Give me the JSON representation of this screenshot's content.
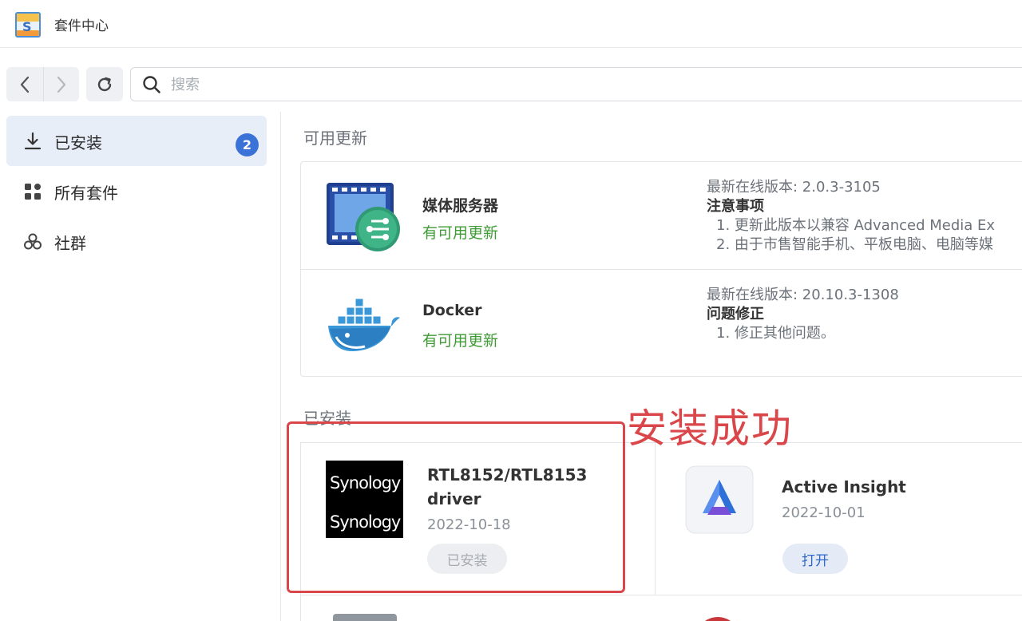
{
  "window": {
    "title": "套件中心",
    "icon": "package-center-icon"
  },
  "toolbar": {
    "back_icon": "chevron-left-icon",
    "forward_icon": "chevron-right-icon",
    "refresh_icon": "refresh-icon",
    "search_placeholder": "搜索",
    "search_value": ""
  },
  "sidebar": {
    "items": [
      {
        "label": "已安装",
        "icon": "download-icon",
        "badge": "2",
        "active": true
      },
      {
        "label": "所有套件",
        "icon": "grid-icon",
        "active": false
      },
      {
        "label": "社群",
        "icon": "community-icon",
        "active": false
      }
    ]
  },
  "updates": {
    "section_title": "可用更新",
    "items": [
      {
        "name": "媒体服务器",
        "status": "有可用更新",
        "icon": "media-server-icon",
        "version": "最新在线版本: 2.0.3-3105",
        "notes_heading": "注意事项",
        "notes": [
          "1. 更新此版本以兼容 Advanced Media Ex",
          "2. 由于市售智能手机、平板电脑、电脑等媒"
        ]
      },
      {
        "name": "Docker",
        "status": "有可用更新",
        "icon": "docker-icon",
        "version": "最新在线版本: 20.10.3-1308",
        "notes_heading": "问题修正",
        "notes": [
          "1. 修正其他问题。"
        ]
      }
    ]
  },
  "installed": {
    "section_title": "已安装",
    "items": [
      {
        "name_line1": "RTL8152/RTL8153",
        "name_line2": "driver",
        "date": "2022-10-18",
        "button": "已安装",
        "icon": "synology-logo-icon",
        "logo_text": "Synology"
      },
      {
        "name": "Active Insight",
        "date": "2022-10-01",
        "button": "打开",
        "icon": "active-insight-icon"
      }
    ]
  },
  "annotation": {
    "text": "安装成功",
    "color": "#d9474a"
  },
  "colors": {
    "accent": "#3a72d8",
    "update_green": "#3f9b35"
  }
}
